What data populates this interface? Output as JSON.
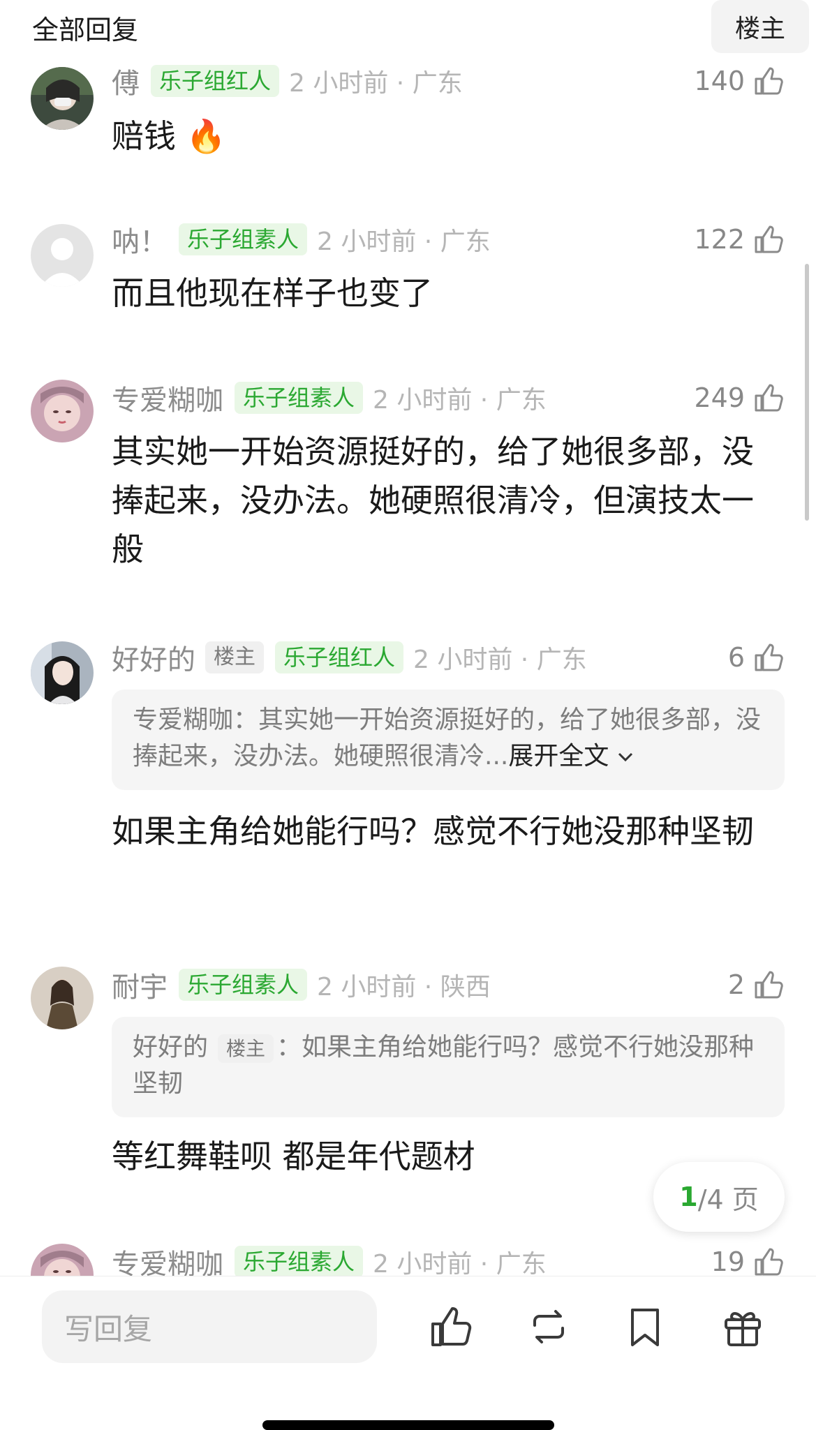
{
  "header": {
    "title": "全部回复",
    "owner_button": "楼主"
  },
  "comments": [
    {
      "user": "傅",
      "badge": "乐子组红人",
      "time": "2 小时前 · 广东",
      "likes": "140",
      "content": "赔钱 🔥"
    },
    {
      "user": "呐！",
      "badge": "乐子组素人",
      "time": "2 小时前 · 广东",
      "likes": "122",
      "content": "而且他现在样子也变了"
    },
    {
      "user": "专爱糊咖",
      "badge": "乐子组素人",
      "time": "2 小时前 · 广东",
      "likes": "249",
      "content": "其实她一开始资源挺好的，给了她很多部，没捧起来，没办法。她硬照很清冷，但演技太一般"
    },
    {
      "user": "好好的",
      "owner_tag": "楼主",
      "badge": "乐子组红人",
      "time": "2 小时前 · 广东",
      "likes": "6",
      "quote": {
        "text": "专爱糊咖：其实她一开始资源挺好的，给了她很多部，没捧起来，没办法。她硬照很清冷...",
        "more": "展开全文"
      },
      "content": "如果主角给她能行吗？感觉不行她没那种坚韧"
    },
    {
      "user": "耐宇",
      "badge": "乐子组素人",
      "time": "2 小时前 · 陕西",
      "likes": "2",
      "quote": {
        "name": "好好的",
        "owner_tag": "楼主",
        "text": "：如果主角给她能行吗？感觉不行她没那种坚韧"
      },
      "content": "等红舞鞋呗 都是年代题材"
    },
    {
      "user": "专爱糊咖",
      "badge": "乐子组素人",
      "time": "2 小时前 · 广东",
      "likes": "19"
    }
  ],
  "pager": {
    "current": "1",
    "rest": "/4 页"
  },
  "bottom": {
    "reply_placeholder": "写回复"
  },
  "colors": {
    "accent_green": "#2aa831",
    "badge_bg": "#e9f7e6"
  },
  "icons": [
    "thumbs-up-icon",
    "repost-icon",
    "bookmark-icon",
    "gift-icon",
    "chevron-down-icon"
  ]
}
